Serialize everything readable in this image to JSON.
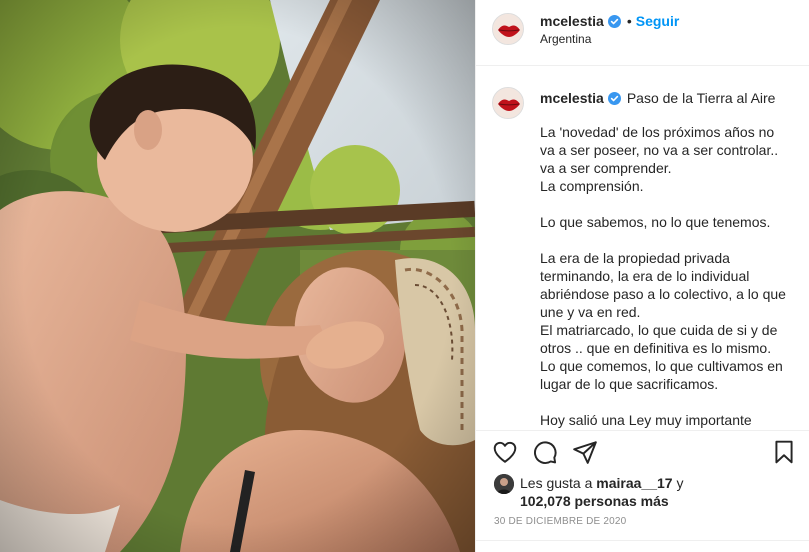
{
  "post": {
    "username": "mcelestia",
    "follow_label": "Seguir",
    "separator": "•",
    "location": "Argentina",
    "caption_title": "Paso de la Tierra al Aire",
    "caption_paragraphs": [
      "La 'novedad' de los próximos años no va a ser poseer, no va a ser controlar.. va a ser comprender.\nLa comprensión.",
      "Lo que sabemos, no lo que tenemos.",
      "La era de la propiedad privada terminando, la era de lo individual abriéndose paso a lo colectivo, a lo que une y va en red.\nEl matriarcado, lo que cuida de si y de otros .. que en definitiva es lo mismo.\nLo que comemos, lo que cultivamos en lugar de lo que sacrificamos.",
      "Hoy salió una Ley muy importante"
    ],
    "likes": {
      "prefix": "Les gusta a ",
      "user": "mairaa__17",
      "mid": " y",
      "count": "102,078",
      "suffix": " personas más"
    },
    "date": "30 DE DICIEMBRE DE 2020"
  },
  "icons": {
    "verified": "verified-badge-icon",
    "like": "heart-icon",
    "comment": "comment-bubble-icon",
    "share": "paper-plane-icon",
    "save": "bookmark-icon"
  },
  "colors": {
    "accent": "#0095f6",
    "verified": "#3897f0",
    "text": "#262626",
    "muted": "#8e8e8e",
    "border": "#efefef"
  }
}
